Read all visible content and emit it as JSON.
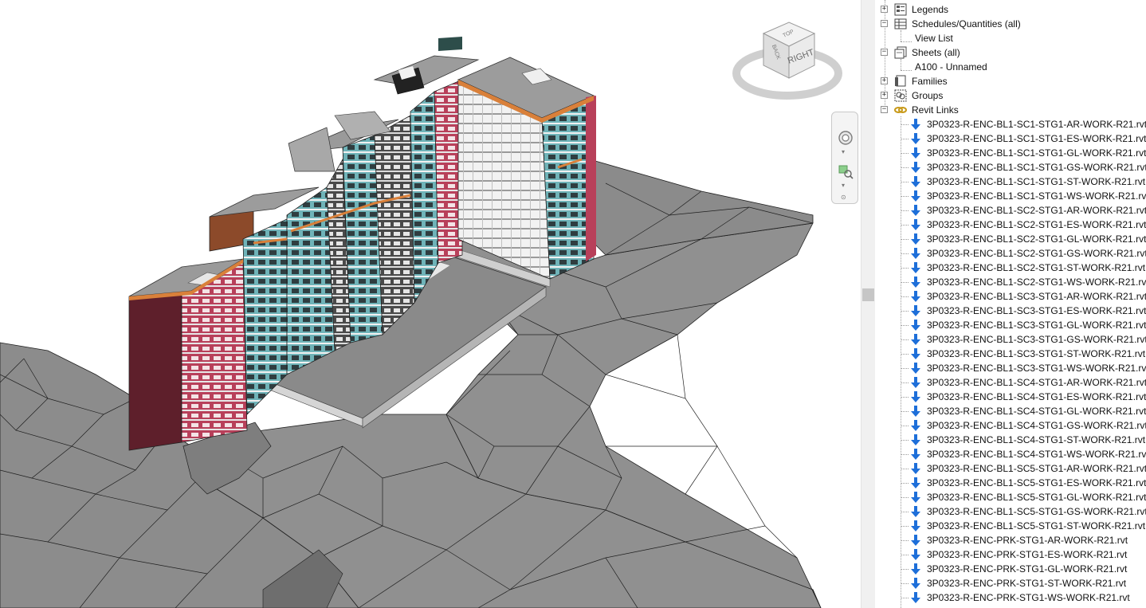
{
  "viewcube": {
    "face_label": "RIGHT",
    "top_label": "TOP",
    "front_label": "BACK",
    "icon": "viewcube-icon"
  },
  "navigation_bar": {
    "wheel_icon": "steering-wheel-icon",
    "zoom_icon": "zoom-region-icon"
  },
  "project_browser": {
    "categories": [
      {
        "label": "Legends",
        "icon": "legends-icon",
        "expander": "+"
      },
      {
        "label": "Schedules/Quantities (all)",
        "icon": "schedules-icon",
        "expander": "−"
      },
      {
        "label": "View List",
        "child": true
      },
      {
        "label": "Sheets (all)",
        "icon": "sheets-icon",
        "expander": "−"
      },
      {
        "label": "A100 - Unnamed",
        "child": true
      },
      {
        "label": "Families",
        "icon": "families-icon",
        "expander": "+"
      },
      {
        "label": "Groups",
        "icon": "groups-icon",
        "expander": "+"
      },
      {
        "label": "Revit Links",
        "icon": "revit-links-icon",
        "expander": "−"
      }
    ],
    "revit_links": [
      "3P0323-R-ENC-BL1-SC1-STG1-AR-WORK-R21.rvt",
      "3P0323-R-ENC-BL1-SC1-STG1-ES-WORK-R21.rvt",
      "3P0323-R-ENC-BL1-SC1-STG1-GL-WORK-R21.rvt",
      "3P0323-R-ENC-BL1-SC1-STG1-GS-WORK-R21.rvt",
      "3P0323-R-ENC-BL1-SC1-STG1-ST-WORK-R21.rvt",
      "3P0323-R-ENC-BL1-SC1-STG1-WS-WORK-R21.rvt",
      "3P0323-R-ENC-BL1-SC2-STG1-AR-WORK-R21.rvt",
      "3P0323-R-ENC-BL1-SC2-STG1-ES-WORK-R21.rvt",
      "3P0323-R-ENC-BL1-SC2-STG1-GL-WORK-R21.rvt",
      "3P0323-R-ENC-BL1-SC2-STG1-GS-WORK-R21.rvt",
      "3P0323-R-ENC-BL1-SC2-STG1-ST-WORK-R21.rvt",
      "3P0323-R-ENC-BL1-SC2-STG1-WS-WORK-R21.rvt",
      "3P0323-R-ENC-BL1-SC3-STG1-AR-WORK-R21.rvt",
      "3P0323-R-ENC-BL1-SC3-STG1-ES-WORK-R21.rvt",
      "3P0323-R-ENC-BL1-SC3-STG1-GL-WORK-R21.rvt",
      "3P0323-R-ENC-BL1-SC3-STG1-GS-WORK-R21.rvt",
      "3P0323-R-ENC-BL1-SC3-STG1-ST-WORK-R21.rvt",
      "3P0323-R-ENC-BL1-SC3-STG1-WS-WORK-R21.rvt",
      "3P0323-R-ENC-BL1-SC4-STG1-AR-WORK-R21.rvt",
      "3P0323-R-ENC-BL1-SC4-STG1-ES-WORK-R21.rvt",
      "3P0323-R-ENC-BL1-SC4-STG1-GL-WORK-R21.rvt",
      "3P0323-R-ENC-BL1-SC4-STG1-GS-WORK-R21.rvt",
      "3P0323-R-ENC-BL1-SC4-STG1-ST-WORK-R21.rvt",
      "3P0323-R-ENC-BL1-SC4-STG1-WS-WORK-R21.rvt",
      "3P0323-R-ENC-BL1-SC5-STG1-AR-WORK-R21.rvt",
      "3P0323-R-ENC-BL1-SC5-STG1-ES-WORK-R21.rvt",
      "3P0323-R-ENC-BL1-SC5-STG1-GL-WORK-R21.rvt",
      "3P0323-R-ENC-BL1-SC5-STG1-GS-WORK-R21.rvt",
      "3P0323-R-ENC-BL1-SC5-STG1-ST-WORK-R21.rvt",
      "3P0323-R-ENC-PRK-STG1-AR-WORK-R21.rvt",
      "3P0323-R-ENC-PRK-STG1-ES-WORK-R21.rvt",
      "3P0323-R-ENC-PRK-STG1-GL-WORK-R21.rvt",
      "3P0323-R-ENC-PRK-STG1-ST-WORK-R21.rvt",
      "3P0323-R-ENC-PRK-STG1-WS-WORK-R21.rvt"
    ],
    "link_icon": "revit-link-arrow-icon"
  },
  "colors": {
    "terrain": "#8f8f8f",
    "facade_red": "#b8405a",
    "facade_cyan": "#7fc1c4",
    "roof": "#9c9c9c",
    "accent_orange": "#d97b2f"
  }
}
